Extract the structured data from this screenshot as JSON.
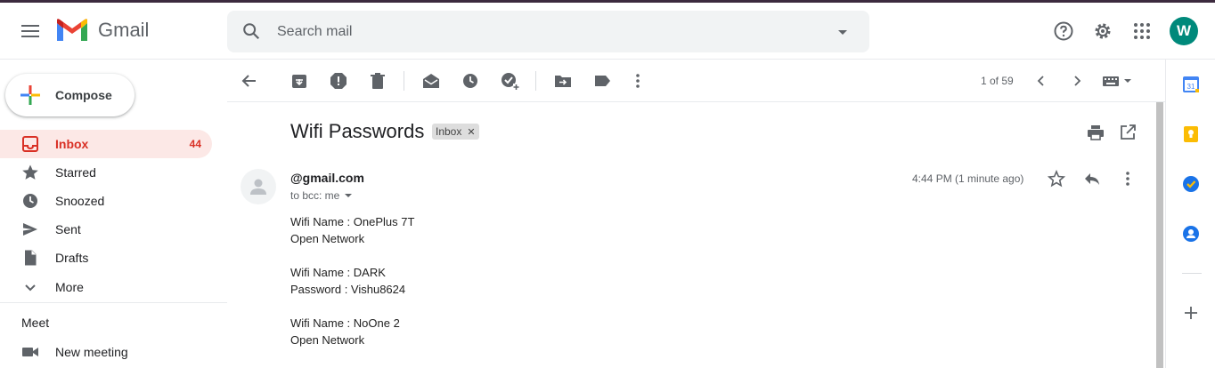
{
  "app": {
    "name": "Gmail"
  },
  "search": {
    "placeholder": "Search mail"
  },
  "header": {
    "avatar_letter": "W"
  },
  "sidebar": {
    "compose_label": "Compose",
    "items": [
      {
        "label": "Inbox",
        "count": "44",
        "icon": "inbox-icon",
        "active": true
      },
      {
        "label": "Starred",
        "icon": "star-icon"
      },
      {
        "label": "Snoozed",
        "icon": "clock-icon"
      },
      {
        "label": "Sent",
        "icon": "send-icon"
      },
      {
        "label": "Drafts",
        "icon": "draft-icon"
      },
      {
        "label": "More",
        "icon": "chevron-down-icon"
      }
    ],
    "meet": {
      "title": "Meet",
      "new_meeting": "New meeting"
    }
  },
  "toolbar": {
    "pager": "1 of 59"
  },
  "email": {
    "subject": "Wifi Passwords",
    "label": "Inbox",
    "sender": "@gmail.com",
    "to": "to bcc: me",
    "time": "4:44 PM (1 minute ago)",
    "body": [
      "Wifi Name : OnePlus 7T",
      "Open Network",
      "",
      "Wifi Name : DARK",
      "Password : Vishu8624",
      "",
      "Wifi Name : NoOne 2",
      "Open Network"
    ]
  },
  "colors": {
    "accent": "#d93025",
    "avatar": "#00897b"
  }
}
